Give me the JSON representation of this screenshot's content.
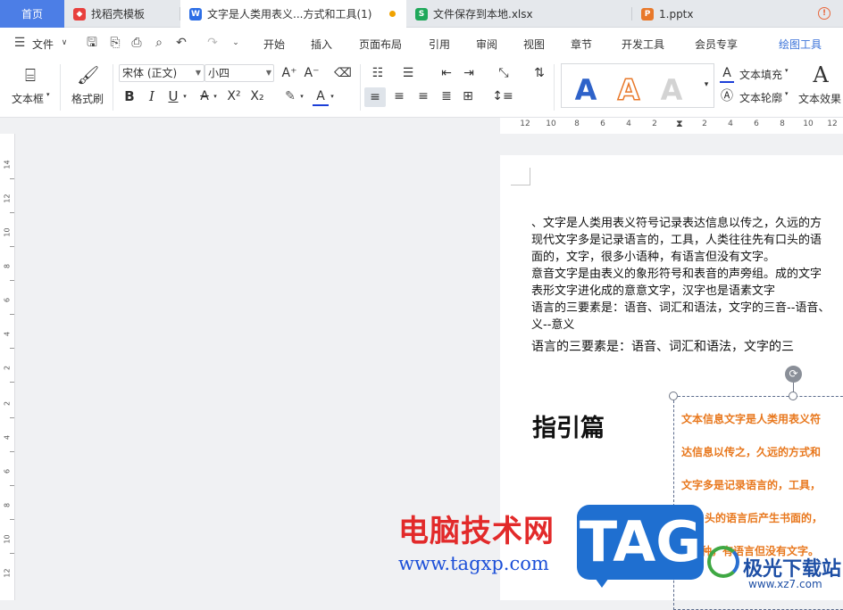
{
  "tabs": {
    "home": "首页",
    "template": "找稻壳模板",
    "doc": "文字是人类用表义...方式和工具(1)",
    "xlsx": "文件保存到本地.xlsx",
    "pptx": "1.pptx",
    "doc_icon": "W",
    "xlsx_icon": "S",
    "pptx_icon": "P"
  },
  "menu": {
    "file": "文件",
    "items": [
      "开始",
      "插入",
      "页面布局",
      "引用",
      "审阅",
      "视图",
      "章节",
      "开发工具",
      "会员专享"
    ],
    "draw_tools": "绘图工具"
  },
  "ribbon": {
    "textbox": "文本框",
    "format_painter": "格式刷",
    "font_name": "宋体 (正文)",
    "font_size": "小四",
    "bold": "B",
    "italic": "I",
    "underline": "U",
    "text_fill": "文本填充",
    "text_outline": "文本轮廓",
    "text_effect": "文本效果",
    "style_letter": "A"
  },
  "ruler": {
    "h_ticks": [
      "12",
      "10",
      "8",
      "6",
      "4",
      "2",
      "2",
      "4",
      "6",
      "8",
      "10",
      "12"
    ],
    "v_ticks": [
      "14",
      "12",
      "10",
      "8",
      "6",
      "4",
      "2",
      "2",
      "4",
      "6",
      "8",
      "10",
      "12"
    ]
  },
  "document": {
    "lines": [
      "、文字是人类用表义符号记录表达信息以传之，久远的方",
      "现代文字多是记录语言的，工具，人类往往先有口头的语",
      "面的，文字，很多小语种，有语言但没有文字。",
      "意音文字是由表义的象形符号和表音的声旁组。成的文字",
      "表形文字进化成的意意文字，汉字也是语素文字",
      "语言的三要素是：语音、词汇和语法，文字的三音--语音、",
      "义--意义",
      "语言的三要素是：语音、词汇和语法，文字的三"
    ],
    "heading": "指引篇",
    "textbox_lines": [
      "文本信息文字是人类用表义符",
      "达信息以传之，久远的方式和",
      "文字多是记录语言的，工具，",
      "头的语言后产生书面的，",
      "种，有语言但没有文字。"
    ]
  },
  "watermark": {
    "cn": "电脑技术网",
    "url": "www.tagxp.com",
    "tag": "TAG",
    "jg": "极光下载站",
    "xz": "www.xz7.com"
  }
}
